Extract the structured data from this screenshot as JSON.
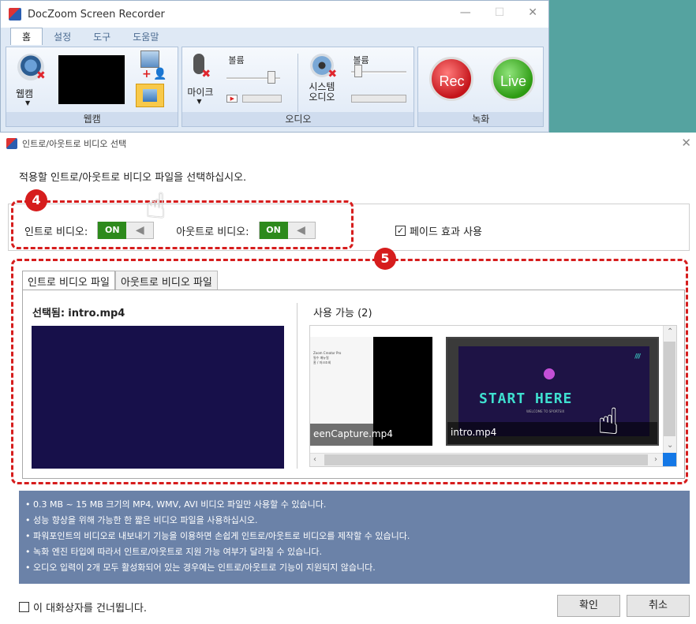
{
  "recorder": {
    "title": "DocZoom Screen Recorder",
    "window_controls": [
      "—",
      "☐",
      "✕"
    ],
    "menu_tabs": [
      "홈",
      "설정",
      "도구",
      "도움말"
    ],
    "groups": {
      "webcam": {
        "label": "웹캠",
        "button_label": "웹캠"
      },
      "audio": {
        "label": "오디오",
        "mic_label": "마이크",
        "system_label_1": "시스템",
        "system_label_2": "오디오",
        "volume_label": "볼륨"
      },
      "record": {
        "label": "녹화",
        "rec_label": "Rec",
        "live_label": "Live"
      }
    }
  },
  "dialog": {
    "title": "인트로/아웃트로 비디오 선택",
    "close": "✕",
    "instruction": "적용할 인트로/아웃트로 비디오 파일을 선택하십시오.",
    "intro_toggle_label": "인트로 비디오:",
    "intro_toggle_state": "ON",
    "outro_toggle_label": "아웃트로 비디오:",
    "outro_toggle_state": "ON",
    "fade_label": "페이드 효과 사용",
    "fade_checked": "✓",
    "badges": {
      "step4": "4",
      "step5": "5"
    },
    "file_tabs": [
      "인트로 비디오 파일",
      "아웃트로 비디오 파일"
    ],
    "selected_prefix": "선택됨:",
    "selected_file": "intro.mp4",
    "available_label": "사용 가능 (2)",
    "thumbnails": [
      {
        "caption": "eenCapture.mp4",
        "doc_text_1": "Zoom Creator Pro",
        "doc_text_2": "필수 매뉴얼",
        "doc_text_3": "홈 / 마크조회"
      },
      {
        "caption": "intro.mp4",
        "headline": "START HERE",
        "subline": "WELCOME TO SPORTSIX"
      }
    ],
    "notes": [
      "• 0.3 MB ~ 15 MB 크기의 MP4, WMV, AVI 비디오 파일만 사용할 수 있습니다.",
      "• 성능 향상을 위해 가능한 한 짧은 비디오 파일을 사용하십시오.",
      "• 파워포인트의 비디오로 내보내기 기능을 이용하면 손쉽게 인트로/아웃트로 비디오를 제작할 수 있습니다.",
      "• 녹화 엔진 타입에 따라서 인트로/아웃트로 지원 가능 여부가 달라질 수 있습니다.",
      "• 오디오 입력이 2개 모두 활성화되어 있는 경우에는 인트로/아웃트로 기능이 지원되지 않습니다."
    ],
    "skip_label": "이 대화상자를 건너뜁니다.",
    "ok_label": "확인",
    "cancel_label": "취소"
  },
  "colors": {
    "accent_red": "#d61d1d",
    "toggle_green": "#2d8a1c",
    "info_bg": "#6b82a8",
    "teal_bg": "#55a3a0"
  }
}
